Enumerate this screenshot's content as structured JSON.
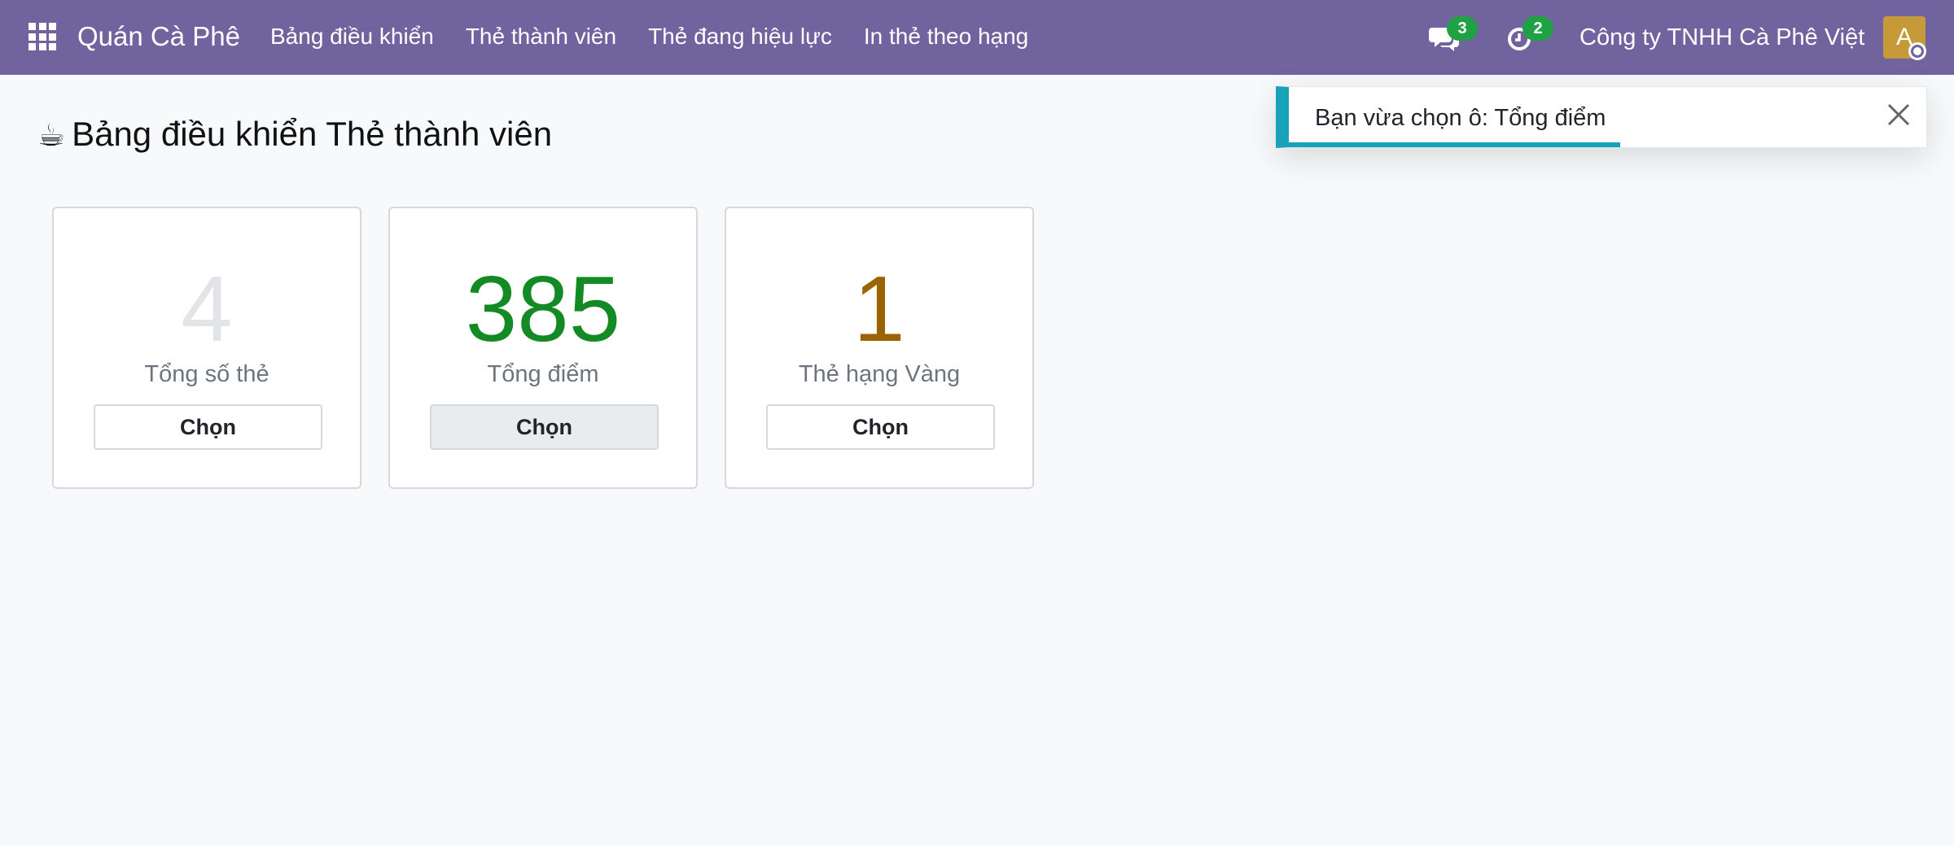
{
  "navbar": {
    "brand": "Quán Cà Phê",
    "menu": [
      "Bảng điều khiển",
      "Thẻ thành viên",
      "Thẻ đang hiệu lực",
      "In thẻ theo hạng"
    ],
    "chat_count": "3",
    "activity_count": "2",
    "company": "Công ty TNHH Cà Phê Việt",
    "avatar_initial": "A"
  },
  "page": {
    "icon": "☕",
    "title": "Bảng điều khiển Thẻ thành viên"
  },
  "cards": [
    {
      "value": "4",
      "label": "Tổng số thẻ",
      "button": "Chọn",
      "color": "#e2e4e8",
      "selected": false
    },
    {
      "value": "385",
      "label": "Tổng điểm",
      "button": "Chọn",
      "color": "#138a24",
      "selected": true
    },
    {
      "value": "1",
      "label": "Thẻ hạng Vàng",
      "button": "Chọn",
      "color": "#9a6500",
      "selected": false
    }
  ],
  "toast": {
    "message": "Bạn vừa chọn ô: Tổng điểm",
    "progress_fraction": 0.52
  },
  "colors": {
    "navbar": "#71639e",
    "badge": "#20a144",
    "toast_accent": "#17a2b8"
  }
}
